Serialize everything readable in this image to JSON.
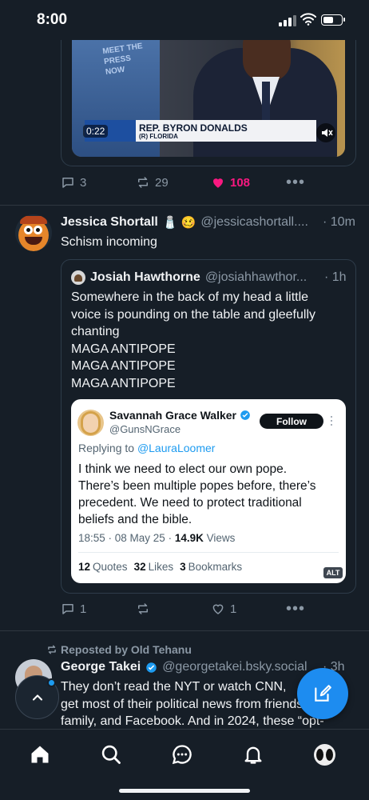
{
  "status_bar": {
    "time": "8:00",
    "battery_level": 0.6
  },
  "top_tweet": {
    "video": {
      "logo_text": "MEET THE PRESS NOW",
      "chyron_name": "REP. BYRON DONALDS",
      "chyron_sub": "(R) FLORIDA",
      "duration": "0:22"
    },
    "actions": {
      "replies": "3",
      "reposts": "29",
      "likes": "108",
      "liked": true
    }
  },
  "tweet2": {
    "author_name": "Jessica Shortall",
    "emoji": "🧂 🥴",
    "handle": "@jessicashortall....",
    "time": "· 10m",
    "text": "Schism incoming",
    "quote": {
      "author_name": "Josiah Hawthorne",
      "handle": "@josiahhawthor...",
      "time": "· 1h",
      "text_lines": [
        "Somewhere in the back of my head a little",
        "voice is pounding on the table and gleefully",
        "chanting",
        "MAGA ANTIPOPE",
        "MAGA ANTIPOPE",
        "MAGA ANTIPOPE"
      ],
      "embedded": {
        "author_name": "Savannah Grace Walker",
        "handle": "@GunsNGrace",
        "follow_label": "Follow",
        "replying_prefix": "Replying to",
        "replying_to": "@LauraLoomer",
        "text_lines": [
          "I think we need to elect our own pope.",
          "There’s been multiple popes before, there’s",
          "precedent. We need to protect traditional",
          "beliefs and the bible."
        ],
        "meta_time": "18:55 · 08 May 25 ·",
        "meta_views_count": "14.9K",
        "meta_views_label": "Views",
        "quotes_count": "12",
        "quotes_label": "Quotes",
        "likes_count": "32",
        "likes_label": "Likes",
        "bookmarks_count": "3",
        "bookmarks_label": "Bookmarks",
        "alt_badge": "ALT"
      }
    },
    "actions": {
      "replies": "1",
      "reposts": "",
      "likes": "1"
    }
  },
  "tweet3": {
    "repost_label": "Reposted by Old Tehanu",
    "author_name": "George Takei",
    "handle": "@georgetakei.bsky.social",
    "time": "· 3h",
    "text_lines": [
      "They don’t read the NYT or watch CNN,",
      "get most of their political news from friends,",
      "family, and Facebook. And in 2024, these “opt-"
    ]
  },
  "tabbar": {
    "tabs": [
      "home-icon",
      "search-icon",
      "chat-icon",
      "notifications-icon",
      "profile-avatar"
    ]
  },
  "colors": {
    "accent": "#1d9bf0",
    "like": "#f91880",
    "background": "#161e27"
  }
}
